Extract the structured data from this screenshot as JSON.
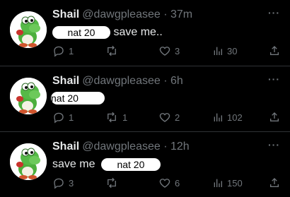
{
  "colors": {
    "background": "#000000",
    "text": "#e7e9ea",
    "muted": "#71767b",
    "divider": "#2f3336"
  },
  "tweets": [
    {
      "name": "Shail",
      "handle": "@dawgpleasee · 37m",
      "pill": "nat 20",
      "text_after": "save me..",
      "text_before": "",
      "replies": "1",
      "retweets": "",
      "likes": "3",
      "views": "30",
      "icons": [
        "reply-icon",
        "retweet-icon",
        "like-icon",
        "views-icon",
        "share-icon"
      ]
    },
    {
      "name": "Shail",
      "handle": "@dawgpleasee · 6h",
      "pill": "nat 20",
      "text_after": "",
      "text_before": "",
      "replies": "1",
      "retweets": "1",
      "likes": "2",
      "views": "102",
      "icons": [
        "reply-icon",
        "retweet-icon",
        "like-icon",
        "views-icon",
        "share-icon"
      ]
    },
    {
      "name": "Shail",
      "handle": "@dawgpleasee · 12h",
      "pill": "nat 20",
      "text_after": "",
      "text_before": "save me",
      "replies": "3",
      "retweets": "",
      "likes": "6",
      "views": "150",
      "icons": [
        "reply-icon",
        "retweet-icon",
        "like-icon",
        "views-icon",
        "share-icon"
      ]
    }
  ]
}
